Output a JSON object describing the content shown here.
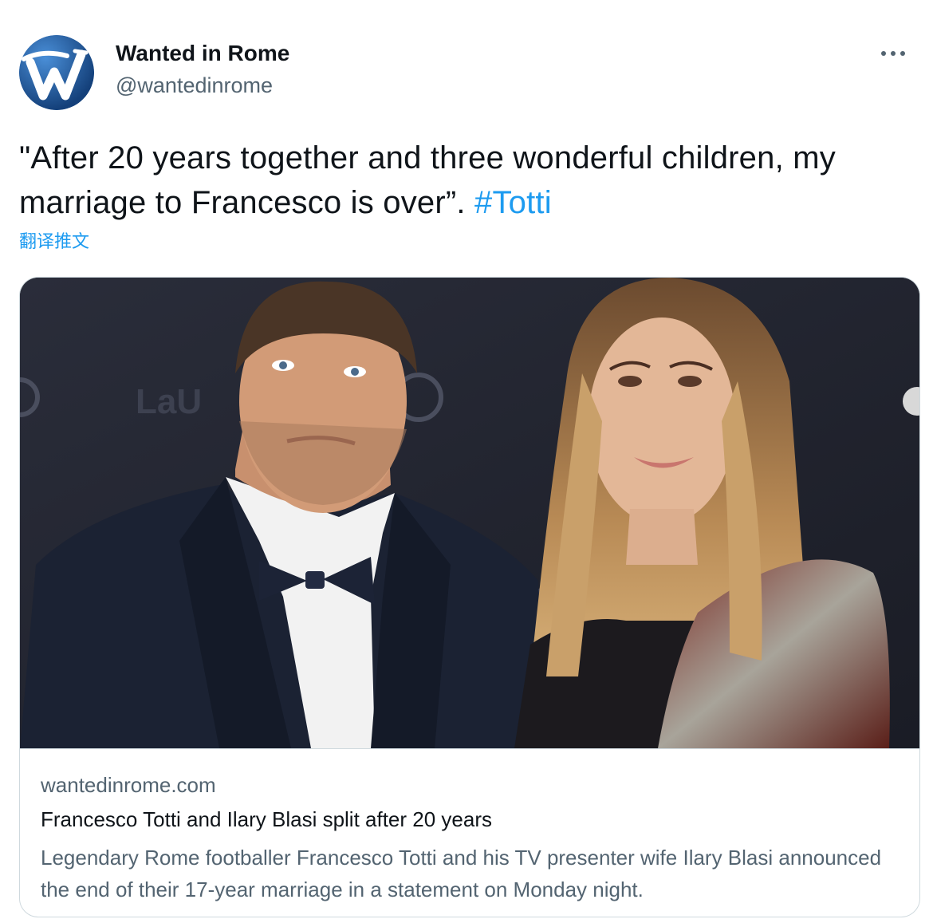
{
  "tweet": {
    "author": {
      "display_name": "Wanted in Rome",
      "handle": "@wantedinrome",
      "avatar_icon": "wanted-in-rome-logo"
    },
    "more_icon": "more-horizontal-icon",
    "text": "\"After 20 years together and three wonderful children, my marriage to Francesco is over”. ",
    "hashtag": "#Totti",
    "translate_label": "翻译推文"
  },
  "link_card": {
    "image_alt": "Francesco Totti and Ilary Blasi on a red carpet",
    "domain": "wantedinrome.com",
    "title": "Francesco Totti and Ilary Blasi split after 20 years",
    "description": "Legendary Rome footballer Francesco Totti and his TV presenter wife Ilary Blasi announced the end of their 17-year marriage in a statement on Monday night."
  },
  "colors": {
    "text": "#0f1419",
    "secondary": "#536471",
    "accent": "#1d9bf0",
    "border": "#cfd9de",
    "logo_blue": "#1f5fa8"
  }
}
